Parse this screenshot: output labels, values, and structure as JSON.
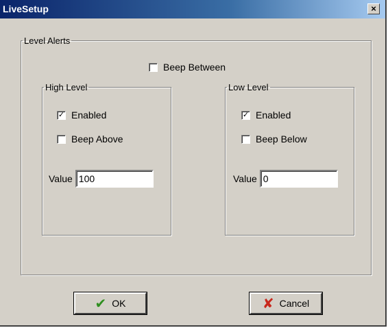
{
  "window": {
    "title": "LiveSetup",
    "close_label": "×"
  },
  "level_alerts": {
    "legend": "Level Alerts",
    "beep_between": {
      "label": "Beep Between",
      "checked": false
    },
    "high_level": {
      "legend": "High Level",
      "enabled": {
        "label": "Enabled",
        "checked": true
      },
      "beep": {
        "label": "Beep Above",
        "checked": false
      },
      "value_label": "Value",
      "value": "100"
    },
    "low_level": {
      "legend": "Low Level",
      "enabled": {
        "label": "Enabled",
        "checked": true
      },
      "beep": {
        "label": "Beep Below",
        "checked": false
      },
      "value_label": "Value",
      "value": "0"
    }
  },
  "buttons": {
    "ok_label": "OK",
    "ok_icon": "checkmark-icon",
    "cancel_label": "Cancel",
    "cancel_icon": "x-icon"
  },
  "colors": {
    "titlebar_start": "#0a246a",
    "titlebar_end": "#a6caf0",
    "dialog_bg": "#d4d0c8",
    "ok_icon": "#2f8f1f",
    "cancel_icon": "#c8281c"
  }
}
